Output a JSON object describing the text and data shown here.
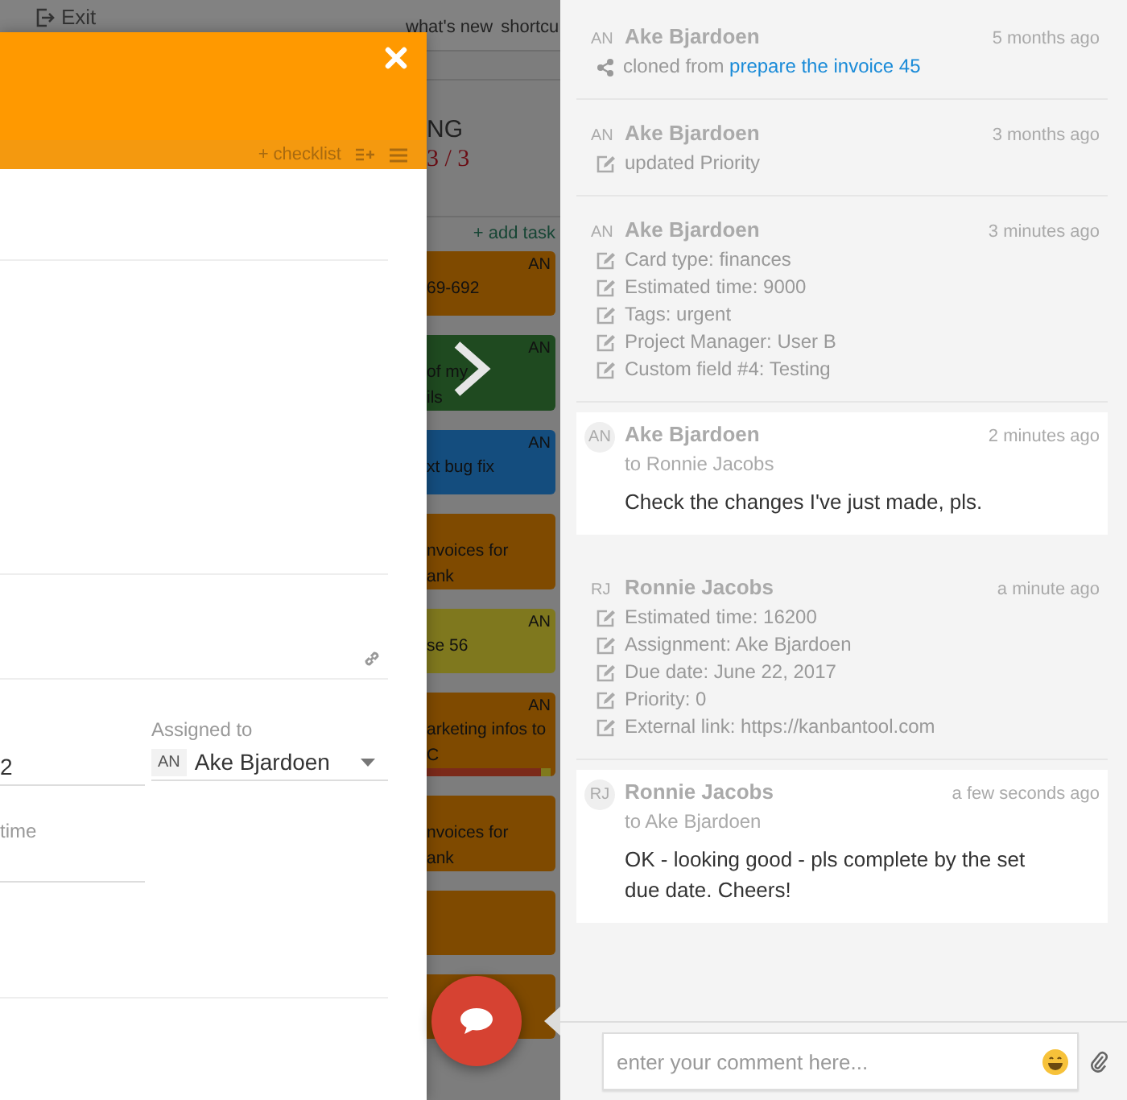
{
  "topbar": {
    "exit": "Exit",
    "links": [
      "what's new",
      "shortcu"
    ]
  },
  "board": {
    "column_title": "NG",
    "count": "3 / 3",
    "add_task": "+ add task",
    "cards": [
      {
        "color": "#7f4a00",
        "initials": "AN",
        "lines": [
          "69-692"
        ]
      },
      {
        "color": "#1f4a20",
        "initials": "AN",
        "lines": [
          "of my",
          "ils"
        ]
      },
      {
        "color": "#144d7e",
        "initials": "AN",
        "lines": [
          "xt bug fix"
        ]
      },
      {
        "color": "#7f4a00",
        "lines": [
          "nvoices for",
          "ank"
        ]
      },
      {
        "color": "#7f781e",
        "initials": "AN",
        "lines": [
          "se 56"
        ]
      },
      {
        "color": "#7f4a00",
        "initials": "AN",
        "lines": [
          "arketing infos to",
          "C"
        ],
        "progress": {
          "level": 0.92
        }
      },
      {
        "color": "#7f4a00",
        "lines": [
          "nvoices for",
          "ank"
        ]
      },
      {
        "color": "#7f4a00"
      },
      {
        "color": "#7f4a00"
      }
    ]
  },
  "card_dialog": {
    "checklist": "+ checklist",
    "field_value": "2",
    "assigned_label": "Assigned to",
    "assignee_initials": "AN",
    "assignee": "Ake Bjardoen",
    "time_label": "time"
  },
  "activity": [
    {
      "kind": "change",
      "initials": "AN",
      "author": "Ake Bjardoen",
      "time": "5 months ago",
      "lines": [
        {
          "kind": "share",
          "text": "cloned from ",
          "link": "prepare the invoice 45"
        }
      ]
    },
    {
      "kind": "change",
      "initials": "AN",
      "author": "Ake Bjardoen",
      "time": "3 months ago",
      "lines": [
        {
          "kind": "edit",
          "text": "updated Priority"
        }
      ]
    },
    {
      "kind": "change",
      "initials": "AN",
      "author": "Ake Bjardoen",
      "time": "3 minutes ago",
      "lines": [
        {
          "kind": "edit",
          "text": "Card type: finances"
        },
        {
          "kind": "edit",
          "text": "Estimated time: 9000"
        },
        {
          "kind": "edit",
          "text": "Tags: urgent"
        },
        {
          "kind": "edit",
          "text": "Project Manager: User B"
        },
        {
          "kind": "edit",
          "text": "Custom field #4: Testing"
        }
      ]
    },
    {
      "kind": "comment",
      "initials": "AN",
      "author": "Ake Bjardoen",
      "recipient": "to Ronnie Jacobs",
      "time": "2 minutes ago",
      "message": "Check the changes I've just made, pls."
    },
    {
      "kind": "change",
      "initials": "RJ",
      "author": "Ronnie Jacobs",
      "time": "a minute ago",
      "lines": [
        {
          "kind": "edit",
          "text": "Estimated time: 16200"
        },
        {
          "kind": "edit",
          "text": "Assignment: Ake Bjardoen"
        },
        {
          "kind": "edit",
          "text": "Due date: June 22, 2017"
        },
        {
          "kind": "edit",
          "text": "Priority: 0"
        },
        {
          "kind": "edit",
          "text": "External link: https://kanbantool.com"
        }
      ]
    },
    {
      "kind": "comment",
      "initials": "RJ",
      "author": "Ronnie Jacobs",
      "recipient": "to Ake Bjardoen",
      "time": "a few seconds ago",
      "message": "OK - looking good - pls complete by the set due date. Cheers!"
    }
  ],
  "comment_box": {
    "placeholder": "enter your comment here..."
  }
}
